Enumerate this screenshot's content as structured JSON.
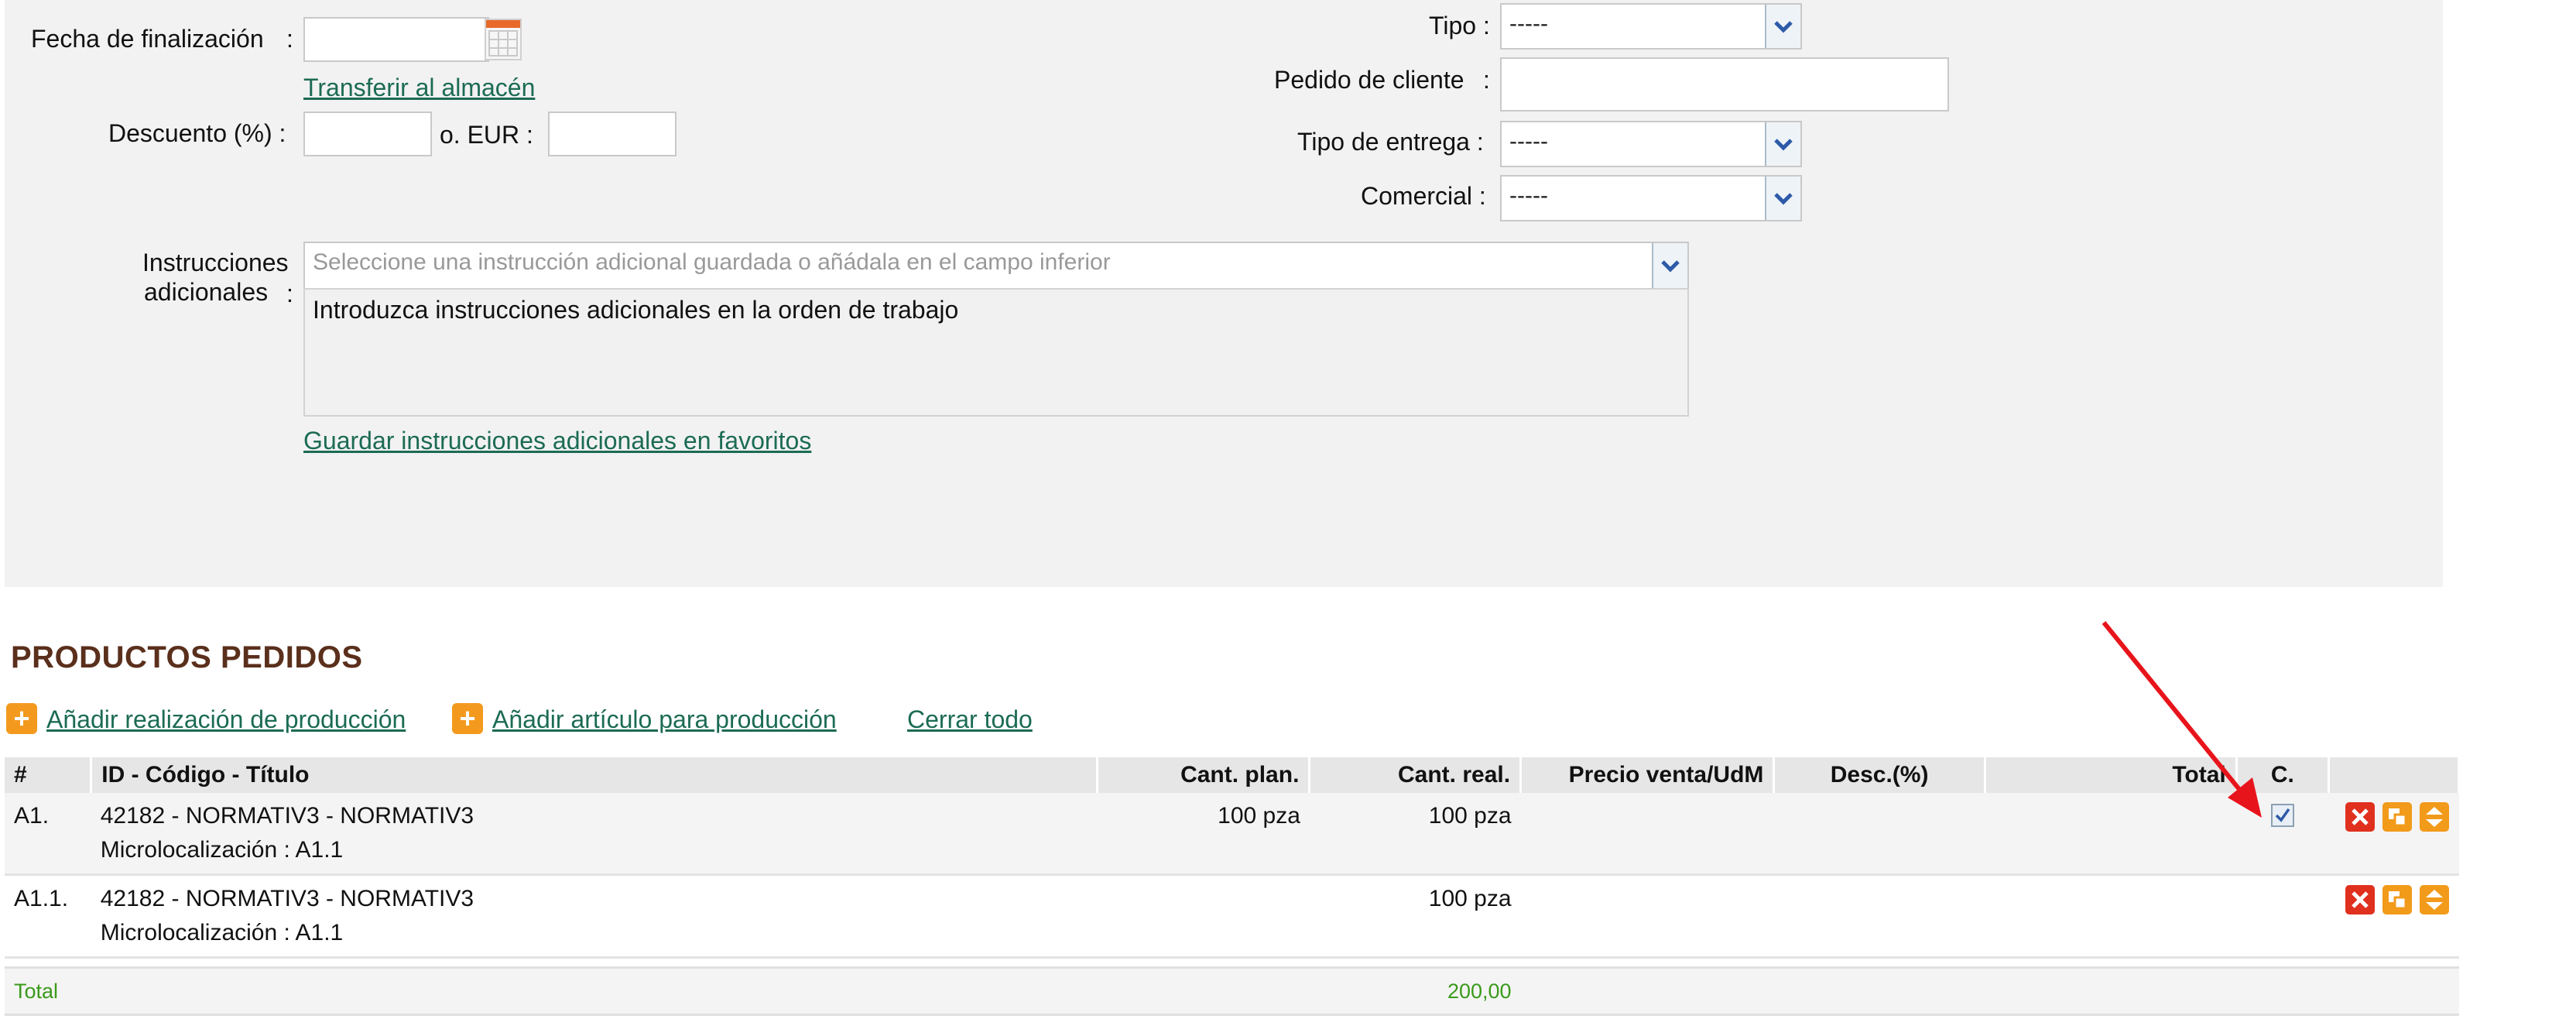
{
  "form": {
    "end_date_label": "Fecha de finalización",
    "end_date_value": "",
    "transfer_link": "Transferir al almacén",
    "discount_label": "Descuento (%) :",
    "discount_value": "",
    "or_eur_label": "o. EUR :",
    "eur_value": "",
    "type_label": "Tipo :",
    "type_value": "-----",
    "customer_order_label": "Pedido de cliente",
    "customer_order_value": "",
    "delivery_type_label": "Tipo de entrega :",
    "delivery_type_value": "-----",
    "sales_rep_label": "Comercial :",
    "sales_rep_value": "-----",
    "instructions_label_line1": "Instrucciones",
    "instructions_label_line2": "adicionales",
    "instructions_select_placeholder": "Seleccione una instrucción adicional guardada o añádala en el campo inferior",
    "instructions_text": "Introduzca instrucciones adicionales en la orden de trabajo",
    "save_favorites_link": "Guardar instrucciones adicionales en favoritos",
    "colon": ":"
  },
  "products": {
    "title": "PRODUCTOS PEDIDOS",
    "add_production_link": "Añadir realización de producción",
    "add_article_link": "Añadir artículo para producción",
    "close_all_link": "Cerrar todo",
    "columns": [
      "#",
      "ID - Código - Título",
      "Cant. plan.",
      "Cant. real.",
      "Precio venta/UdM",
      "Desc.(%)",
      "Total",
      "C."
    ],
    "rows": [
      {
        "num": "A1.",
        "title": "42182 - NORMATIV3 - NORMATIV3",
        "sub": "Microlocalización : A1.1",
        "planned": "100 pza",
        "actual": "100 pza",
        "price": "",
        "discount": "",
        "total": "",
        "checked": true
      },
      {
        "num": "A1.1.",
        "title": "42182 - NORMATIV3 - NORMATIV3",
        "sub": "Microlocalización : A1.1",
        "planned": "",
        "actual": "100 pza",
        "price": "",
        "discount": "",
        "total": "",
        "checked": false
      }
    ],
    "total_label": "Total",
    "total_actual": "200,00"
  },
  "icons": {
    "calendar": "calendar-icon",
    "dropdown": "chevron-down-icon",
    "add": "plus-icon",
    "delete": "delete-icon",
    "duplicate": "duplicate-icon",
    "move": "move-icon"
  },
  "colors": {
    "link": "#1c6b54",
    "section_title": "#5a2f1c",
    "total_green": "#3a9a1a",
    "annotation_arrow": "#e8141b"
  }
}
